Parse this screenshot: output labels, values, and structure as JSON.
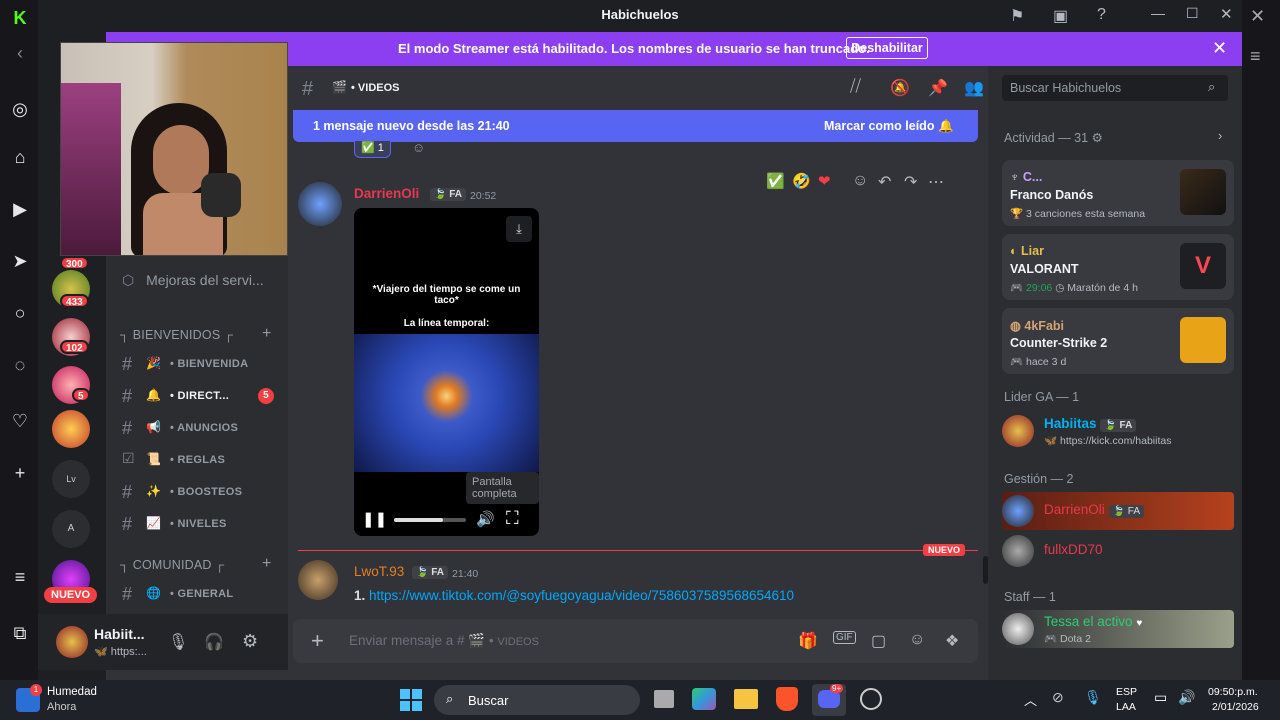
{
  "window": {
    "title": "Habichuelos"
  },
  "banner": {
    "message": "El modo Streamer está habilitado. Los nombres de usuario se han truncado.",
    "button": "Deshabilitar"
  },
  "rail_badges": [
    "300",
    "433",
    "102",
    "5"
  ],
  "rail_new_label": "NUEVO",
  "channels": {
    "top_item": "Mejoras del servi...",
    "categories": [
      {
        "name": "BIENVENIDOS",
        "items": [
          {
            "label": "BIENVENIDA",
            "emoji": "🎉"
          },
          {
            "label": "DIRECT...",
            "emoji": "🔔",
            "badge": "5"
          },
          {
            "label": "ANUNCIOS",
            "emoji": "📢"
          },
          {
            "label": "REGLAS",
            "emoji": "📜"
          },
          {
            "label": "BOOSTEOS",
            "emoji": "✨"
          },
          {
            "label": "NIVELES",
            "emoji": "📈"
          }
        ]
      },
      {
        "name": "COMUNIDAD",
        "items": [
          {
            "label": "GENERAL",
            "emoji": "🌐"
          }
        ]
      }
    ]
  },
  "user": {
    "name": "Habiit...",
    "status": "https:..."
  },
  "chat": {
    "channel": "VIDEOS",
    "new_messages": "1 mensaje nuevo desde las 21:40",
    "mark_read": "Marcar como leído",
    "reaction_count": "1",
    "messages": [
      {
        "user": "DarrienOli",
        "tag": "FA",
        "time": "20:52",
        "user_color": "#e8384f"
      },
      {
        "user": "LwoT.93",
        "tag": "FA",
        "time": "21:40",
        "user_color": "#e67e22",
        "text_num": "1.",
        "link": "https://www.tiktok.com/@soyfuegoyagua/video/7586037589568654610"
      }
    ],
    "video": {
      "caption": "*Viajero del tiempo se come un taco*",
      "caption2": "La línea temporal:",
      "tooltip": "Pantalla completa"
    },
    "new_divider": "NUEVO",
    "composer_placeholder": "Enviar mensaje a #",
    "composer_channel": "VIDEOS"
  },
  "members": {
    "search_placeholder": "Buscar Habichuelos",
    "activity_header": "Actividad — 31",
    "activities": [
      {
        "user": "C...",
        "title": "Franco Danós",
        "detail": "3 canciones esta semana",
        "user_color": "#c9a0ff"
      },
      {
        "user": "Liar",
        "title": "VALORANT",
        "detail_time": "29:06",
        "detail": "Maratón de 4 h",
        "user_color": "#e5c04a"
      },
      {
        "user": "4kFabi",
        "title": "Counter-Strike 2",
        "detail": "hace 3 d",
        "user_color": "#d4a373"
      }
    ],
    "groups": [
      {
        "name": "Lider GA — 1",
        "members": [
          {
            "name": "Habiitas",
            "tag": "FA",
            "status": "https://kick.com/habiitas",
            "color": "#00b0f4"
          }
        ]
      },
      {
        "name": "Gestión — 2",
        "members": [
          {
            "name": "DarrienOli",
            "tag": "FA",
            "status": "",
            "color": "#e8384f"
          },
          {
            "name": "fullxDD70",
            "status": "",
            "color": "#e8384f"
          }
        ]
      },
      {
        "name": "Staff — 1",
        "members": [
          {
            "name": "Tessa el activo",
            "status": "Dota 2",
            "color": "#2ecc71"
          }
        ]
      }
    ]
  },
  "taskbar": {
    "notif_title": "Humedad",
    "notif_sub": "Ahora",
    "search": "Buscar",
    "lang1": "ESP",
    "lang2": "LAA",
    "time": "09:50:p.m.",
    "date": "2/01/2026",
    "discord_badge": "9+"
  }
}
